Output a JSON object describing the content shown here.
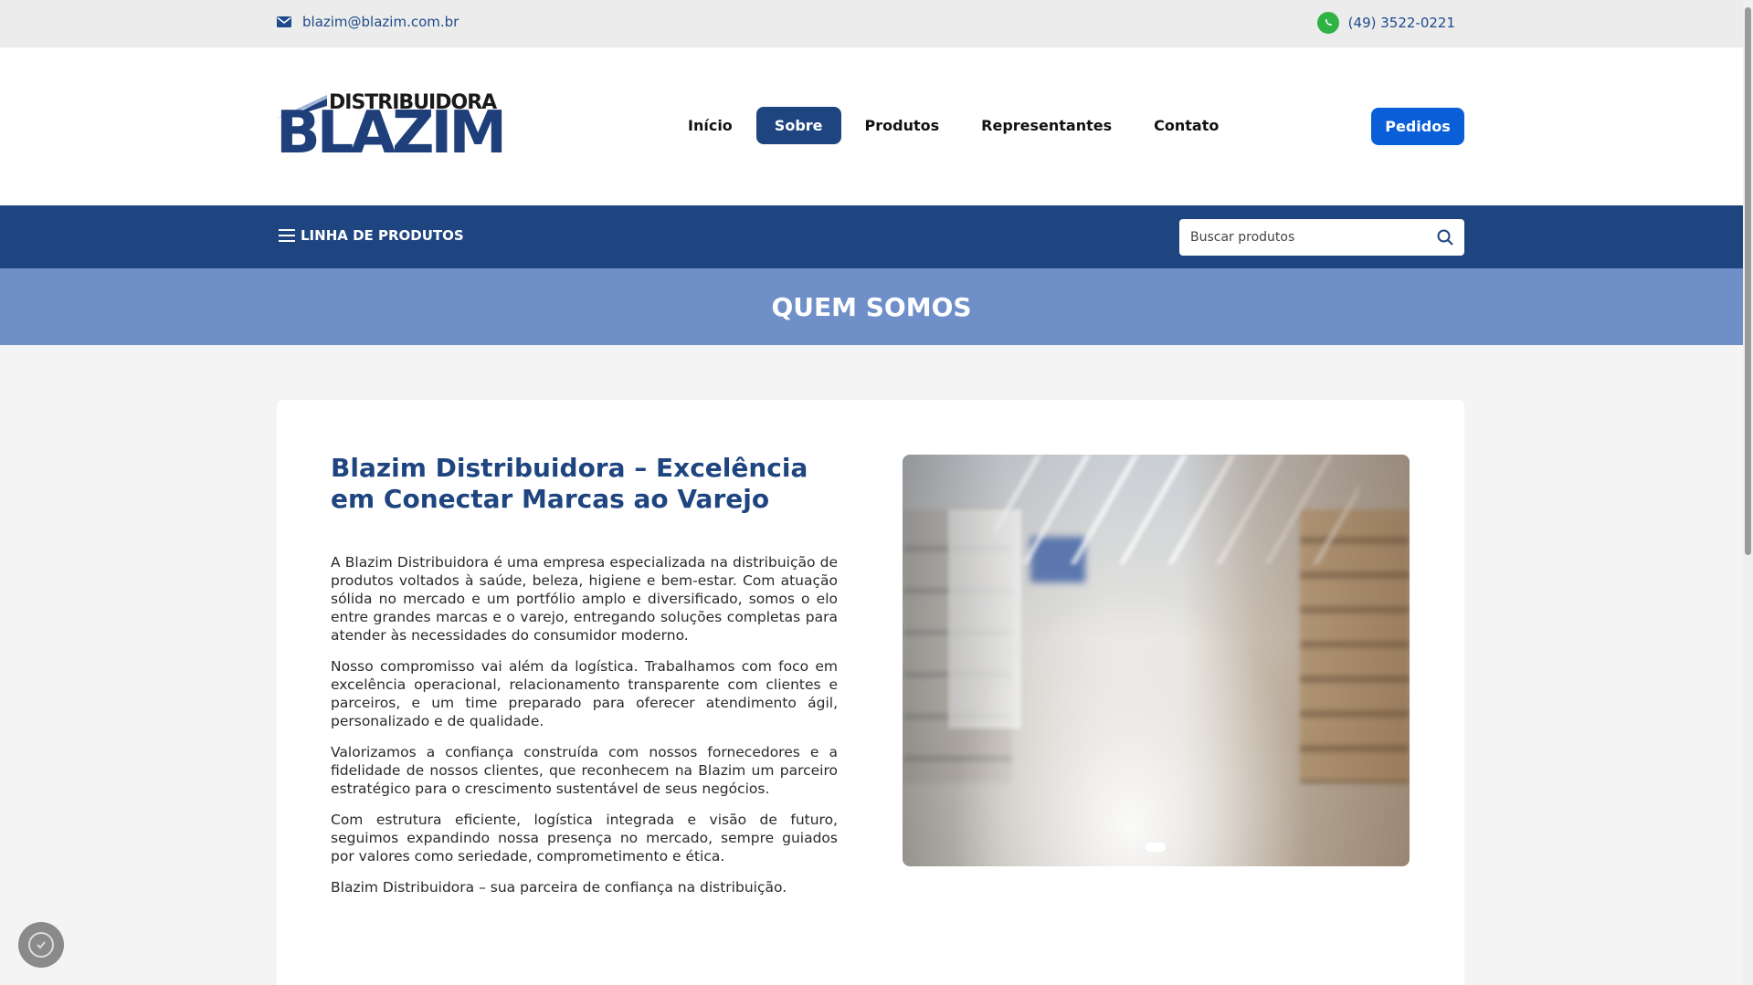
{
  "topbar": {
    "email": "blazim@blazim.com.br",
    "phone": "(49) 3522-0221"
  },
  "logo": {
    "line1": "DISTRIBUIDORA",
    "line2": "BLAZIM"
  },
  "nav": {
    "items": [
      "Início",
      "Sobre",
      "Produtos",
      "Representantes",
      "Contato"
    ],
    "active": "Sobre",
    "cta": "Pedidos"
  },
  "catbar": {
    "menu_label": "LINHA DE PRODUTOS",
    "search_placeholder": "Buscar produtos"
  },
  "banner": {
    "title": "QUEM SOMOS"
  },
  "about": {
    "heading": "Blazim Distribuidora – Excelência em Conectar Marcas ao Varejo",
    "paragraphs": [
      "A Blazim Distribuidora é uma empresa especializada na distribuição de produtos voltados à saúde, beleza, higiene e bem-estar. Com atuação sólida no mercado e um portfólio amplo e diversificado, somos o elo entre grandes marcas e o varejo, entregando soluções completas para atender às necessidades do consumidor moderno.",
      "Nosso compromisso vai além da logística. Trabalhamos com foco em excelência operacional, relacionamento transparente com clientes e parceiros, e um time preparado para oferecer atendimento ágil, personalizado e de qualidade.",
      "Valorizamos a confiança construída com nossos fornecedores e a fidelidade de nossos clientes, que reconhecem na Blazim um parceiro estratégico para o crescimento sustentável de seus negócios.",
      "Com estrutura eficiente, logística integrada e visão de futuro, seguimos expandindo nossa presença no mercado, sempre guiados por valores como seriedade, comprometimento e ética.",
      "Blazim Distribuidora – sua parceira de confiança na distribuição."
    ]
  },
  "colors": {
    "brand_blue": "#1e4580",
    "cta_blue": "#0a5fd8",
    "banner_blue": "#6f8fc9",
    "whatsapp_green": "#2fb344"
  },
  "icons": {
    "email": "mail-icon",
    "phone": "whatsapp-icon",
    "menu": "hamburger-icon",
    "search": "search-icon",
    "consent": "shield-check-icon"
  }
}
